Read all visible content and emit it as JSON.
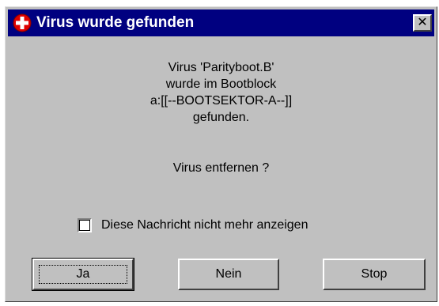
{
  "window": {
    "title": "Virus wurde gefunden",
    "icon": "red-cross-shield-icon",
    "close_glyph": "✕"
  },
  "message": {
    "line1": "Virus 'Parityboot.B'",
    "line2": "wurde im Bootblock",
    "line3": "a:[[--BOOTSEKTOR-A--]]",
    "line4": "gefunden.",
    "question": "Virus entfernen ?"
  },
  "checkbox": {
    "label": "Diese Nachricht nicht mehr anzeigen",
    "checked": false
  },
  "buttons": {
    "yes": "Ja",
    "no": "Nein",
    "stop": "Stop"
  },
  "colors": {
    "titlebar": "#000080",
    "face": "#c0c0c0",
    "icon_red": "#e00000"
  }
}
